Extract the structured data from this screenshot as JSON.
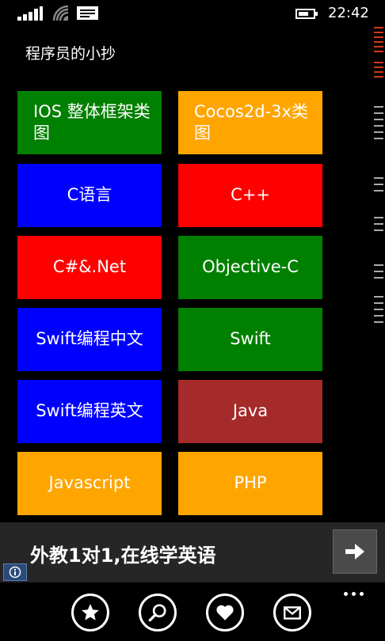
{
  "status_bar": {
    "time": "22:42"
  },
  "app": {
    "title": "程序员的小抄"
  },
  "tiles": [
    {
      "label": "IOS 整体框架类图",
      "color": "#008000"
    },
    {
      "label": "Cocos2d-3x类图",
      "color": "#FFA500"
    },
    {
      "label": "C语言",
      "color": "#0000FF"
    },
    {
      "label": "C++",
      "color": "#FF0000"
    },
    {
      "label": "C#&.Net",
      "color": "#FF0000"
    },
    {
      "label": "Objective-C",
      "color": "#008000"
    },
    {
      "label": "Swift编程中文",
      "color": "#0000FF"
    },
    {
      "label": "Swift",
      "color": "#008000"
    },
    {
      "label": "Swift编程英文",
      "color": "#0000FF"
    },
    {
      "label": "Java",
      "color": "#A52A2A"
    },
    {
      "label": "Javascript",
      "color": "#FFA500"
    },
    {
      "label": "PHP",
      "color": "#FFA500"
    }
  ],
  "ad": {
    "text": "外教1对1,在线学英语",
    "arrow_icon": "arrow-right-icon",
    "badge_icon": "info-icon"
  },
  "app_bar": {
    "buttons": [
      {
        "icon": "star-icon"
      },
      {
        "icon": "search-icon"
      },
      {
        "icon": "heart-icon"
      },
      {
        "icon": "mail-icon"
      }
    ],
    "more_icon": "more-dots-icon"
  },
  "colors": {
    "background": "#000000",
    "side_indicator": "#D2381B"
  }
}
